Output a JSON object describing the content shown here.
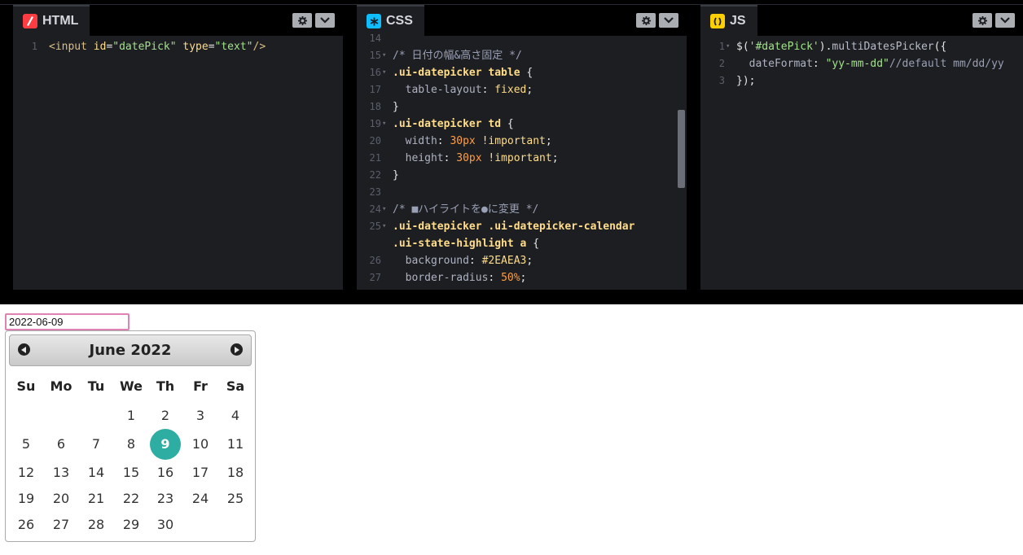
{
  "editors": {
    "html": {
      "label": "HTML",
      "icon": "html-icon",
      "icon_color": "#ff3c41",
      "lines": [
        {
          "n": "1",
          "parts": [
            {
              "t": "<input ",
              "c": "tag"
            },
            {
              "t": "id",
              "c": "attr"
            },
            {
              "t": "=",
              "c": "punct"
            },
            {
              "t": "\"datePick\"",
              "c": "str"
            },
            {
              "t": " type",
              "c": "attr"
            },
            {
              "t": "=",
              "c": "punct"
            },
            {
              "t": "\"text\"",
              "c": "str"
            },
            {
              "t": "/>",
              "c": "tag"
            }
          ]
        }
      ]
    },
    "css": {
      "label": "CSS",
      "icon": "css-icon",
      "icon_color": "#0ebeff",
      "lines": [
        {
          "n": "14",
          "fold": false,
          "parts": []
        },
        {
          "n": "15",
          "fold": true,
          "parts": [
            {
              "t": "/* 日付の幅&高さ固定 */",
              "c": "comment"
            }
          ]
        },
        {
          "n": "16",
          "fold": true,
          "parts": [
            {
              "t": ".ui-datepicker table",
              "c": "sel"
            },
            {
              "t": " {",
              "c": "punct"
            }
          ]
        },
        {
          "n": "17",
          "fold": false,
          "parts": [
            {
              "t": "  table-layout",
              "c": "prop"
            },
            {
              "t": ": ",
              "c": "punct"
            },
            {
              "t": "fixed",
              "c": "val"
            },
            {
              "t": ";",
              "c": "punct"
            }
          ]
        },
        {
          "n": "18",
          "fold": false,
          "parts": [
            {
              "t": "}",
              "c": "punct"
            }
          ]
        },
        {
          "n": "19",
          "fold": true,
          "parts": [
            {
              "t": ".ui-datepicker td",
              "c": "sel"
            },
            {
              "t": " {",
              "c": "punct"
            }
          ]
        },
        {
          "n": "20",
          "fold": false,
          "parts": [
            {
              "t": "  width",
              "c": "prop"
            },
            {
              "t": ": ",
              "c": "punct"
            },
            {
              "t": "30px",
              "c": "num"
            },
            {
              "t": " !important",
              "c": "val"
            },
            {
              "t": ";",
              "c": "punct"
            }
          ]
        },
        {
          "n": "21",
          "fold": false,
          "parts": [
            {
              "t": "  height",
              "c": "prop"
            },
            {
              "t": ": ",
              "c": "punct"
            },
            {
              "t": "30px",
              "c": "num"
            },
            {
              "t": " !important",
              "c": "val"
            },
            {
              "t": ";",
              "c": "punct"
            }
          ]
        },
        {
          "n": "22",
          "fold": false,
          "parts": [
            {
              "t": "}",
              "c": "punct"
            }
          ]
        },
        {
          "n": "23",
          "fold": false,
          "parts": []
        },
        {
          "n": "24",
          "fold": true,
          "parts": [
            {
              "t": "/* ■ハイライトを●に変更 */",
              "c": "comment"
            }
          ]
        },
        {
          "n": "25",
          "fold": true,
          "parts": [
            {
              "t": ".ui-datepicker .ui-datepicker-calendar",
              "c": "sel"
            }
          ]
        },
        {
          "n": "",
          "fold": false,
          "parts": [
            {
              "t": ".ui-state-highlight a",
              "c": "sel"
            },
            {
              "t": " {",
              "c": "punct"
            }
          ]
        },
        {
          "n": "26",
          "fold": false,
          "parts": [
            {
              "t": "  background",
              "c": "prop"
            },
            {
              "t": ": ",
              "c": "punct"
            },
            {
              "t": "#2EAEA3",
              "c": "val"
            },
            {
              "t": ";",
              "c": "punct"
            }
          ]
        },
        {
          "n": "27",
          "fold": false,
          "parts": [
            {
              "t": "  border-radius",
              "c": "prop"
            },
            {
              "t": ": ",
              "c": "punct"
            },
            {
              "t": "50%",
              "c": "num"
            },
            {
              "t": ";",
              "c": "punct"
            }
          ]
        }
      ]
    },
    "js": {
      "label": "JS",
      "icon": "js-icon",
      "icon_color": "#fcd000",
      "lines": [
        {
          "n": "1",
          "fold": true,
          "parts": [
            {
              "t": "$(",
              "c": "punct"
            },
            {
              "t": "'#datePick'",
              "c": "str"
            },
            {
              "t": ").",
              "c": "punct"
            },
            {
              "t": "multiDatesPicker",
              "c": "fn"
            },
            {
              "t": "({",
              "c": "punct"
            }
          ]
        },
        {
          "n": "2",
          "fold": false,
          "parts": [
            {
              "t": "  dateFormat",
              "c": "prop"
            },
            {
              "t": ": ",
              "c": "punct"
            },
            {
              "t": "\"yy-mm-dd\"",
              "c": "str"
            },
            {
              "t": "//default mm/dd/yy",
              "c": "js-comment"
            }
          ]
        },
        {
          "n": "3",
          "fold": false,
          "parts": [
            {
              "t": "});",
              "c": "punct"
            }
          ]
        }
      ]
    }
  },
  "result": {
    "input_value": "2022-06-09",
    "calendar": {
      "title": "June 2022",
      "weekdays": [
        "Su",
        "Mo",
        "Tu",
        "We",
        "Th",
        "Fr",
        "Sa"
      ],
      "weeks": [
        [
          "",
          "",
          "",
          "1",
          "2",
          "3",
          "4"
        ],
        [
          "5",
          "6",
          "7",
          "8",
          "9",
          "10",
          "11"
        ],
        [
          "12",
          "13",
          "14",
          "15",
          "16",
          "17",
          "18"
        ],
        [
          "19",
          "20",
          "21",
          "22",
          "23",
          "24",
          "25"
        ],
        [
          "26",
          "27",
          "28",
          "29",
          "30",
          "",
          ""
        ]
      ],
      "selected_day": "9",
      "highlight_color": "#2EAEA3"
    }
  }
}
